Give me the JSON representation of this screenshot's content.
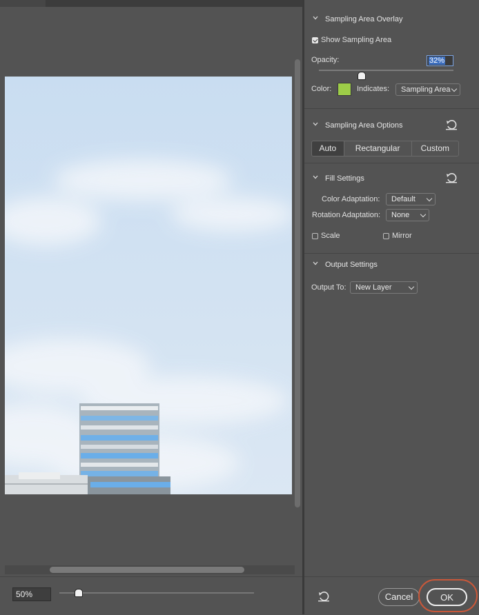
{
  "preview": {
    "zoom_value": "50%",
    "zoom_fraction": 0.1
  },
  "panel": {
    "sampling_overlay": {
      "title": "Sampling Area Overlay",
      "show_label": "Show Sampling Area",
      "show_checked": true,
      "opacity_label": "Opacity:",
      "opacity_value": "32%",
      "opacity_fraction": 0.32,
      "color_label": "Color:",
      "color_hex": "#9dcd48",
      "indicates_label": "Indicates:",
      "indicates_value": "Sampling Area"
    },
    "sampling_options": {
      "title": "Sampling Area Options",
      "segments": [
        "Auto",
        "Rectangular",
        "Custom"
      ],
      "active_segment": "Auto"
    },
    "fill_settings": {
      "title": "Fill Settings",
      "color_adaptation_label": "Color Adaptation:",
      "color_adaptation_value": "Default",
      "rotation_adaptation_label": "Rotation Adaptation:",
      "rotation_adaptation_value": "None",
      "scale_label": "Scale",
      "mirror_label": "Mirror"
    },
    "output_settings": {
      "title": "Output Settings",
      "output_to_label": "Output To:",
      "output_to_value": "New Layer"
    },
    "buttons": {
      "cancel": "Cancel",
      "ok": "OK"
    }
  },
  "icons": [
    "chevron-down-icon",
    "reset-icon",
    "checkbox-icon",
    "slider-thumb-icon",
    "caret-down-icon"
  ]
}
